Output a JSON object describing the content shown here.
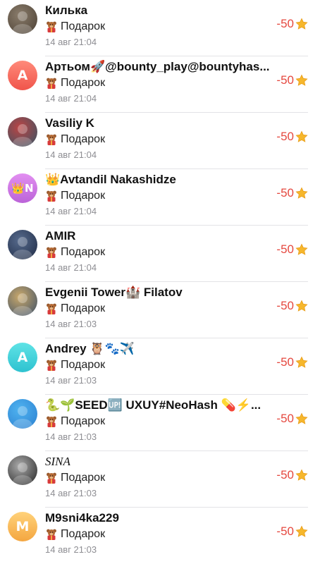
{
  "colors": {
    "amount": "#e5483f",
    "time": "#8e8e93",
    "divider": "#e3e3e6"
  },
  "transactions": [
    {
      "name": "Килька",
      "avatar": {
        "type": "photo",
        "colors": [
          "#8a7c6b",
          "#4a3f33"
        ]
      },
      "gift_label": "Подарок",
      "time": "14 авг 21:04",
      "amount": "-50"
    },
    {
      "name": "Артьом🚀@bounty_play@bountyhas...",
      "avatar": {
        "type": "letter",
        "letter": "A",
        "colors": [
          "#ff8a7a",
          "#f0554b"
        ]
      },
      "gift_label": "Подарок",
      "time": "14 авг 21:04",
      "amount": "-50"
    },
    {
      "name": "Vasiliy K",
      "avatar": {
        "type": "photo",
        "colors": [
          "#b44",
          "#356"
        ]
      },
      "gift_label": "Подарок",
      "time": "14 авг 21:04",
      "amount": "-50"
    },
    {
      "name": "👑Avtandil Nakashidze",
      "avatar": {
        "type": "letter",
        "letter": "👑N",
        "colors": [
          "#e28ff1",
          "#bb63d8"
        ]
      },
      "gift_label": "Подарок",
      "time": "14 авг 21:04",
      "amount": "-50"
    },
    {
      "name": "AMIR",
      "avatar": {
        "type": "photo",
        "colors": [
          "#566a8c",
          "#1e2a44"
        ]
      },
      "gift_label": "Подарок",
      "time": "14 авг 21:04",
      "amount": "-50"
    },
    {
      "name": "Evgenii Tower🏰 Filatov",
      "avatar": {
        "type": "photo",
        "colors": [
          "#c9a86a",
          "#3b4f68"
        ]
      },
      "gift_label": "Подарок",
      "time": "14 авг 21:03",
      "amount": "-50"
    },
    {
      "name": "Andrey 🦉🐾✈️",
      "avatar": {
        "type": "letter",
        "letter": "A",
        "colors": [
          "#5fe3e6",
          "#2ec2d0"
        ]
      },
      "gift_label": "Подарок",
      "time": "14 авг 21:03",
      "amount": "-50"
    },
    {
      "name": "🐍🌱SEED🆙 UXUY#NeoHash 💊⚡...",
      "avatar": {
        "type": "photo",
        "colors": [
          "#4fb3f0",
          "#2b7fd0"
        ]
      },
      "gift_label": "Подарок",
      "time": "14 авг 21:03",
      "amount": "-50"
    },
    {
      "name": "SINA",
      "name_style": "serif-italic",
      "avatar": {
        "type": "photo",
        "colors": [
          "#aaaaaa",
          "#222222"
        ]
      },
      "gift_label": "Подарок",
      "time": "14 авг 21:03",
      "amount": "-50"
    },
    {
      "name": "M9sni4ka229",
      "avatar": {
        "type": "letter",
        "letter": "M",
        "colors": [
          "#ffd27a",
          "#f4a640"
        ]
      },
      "gift_label": "Подарок",
      "time": "14 авг 21:03",
      "amount": "-50"
    }
  ]
}
